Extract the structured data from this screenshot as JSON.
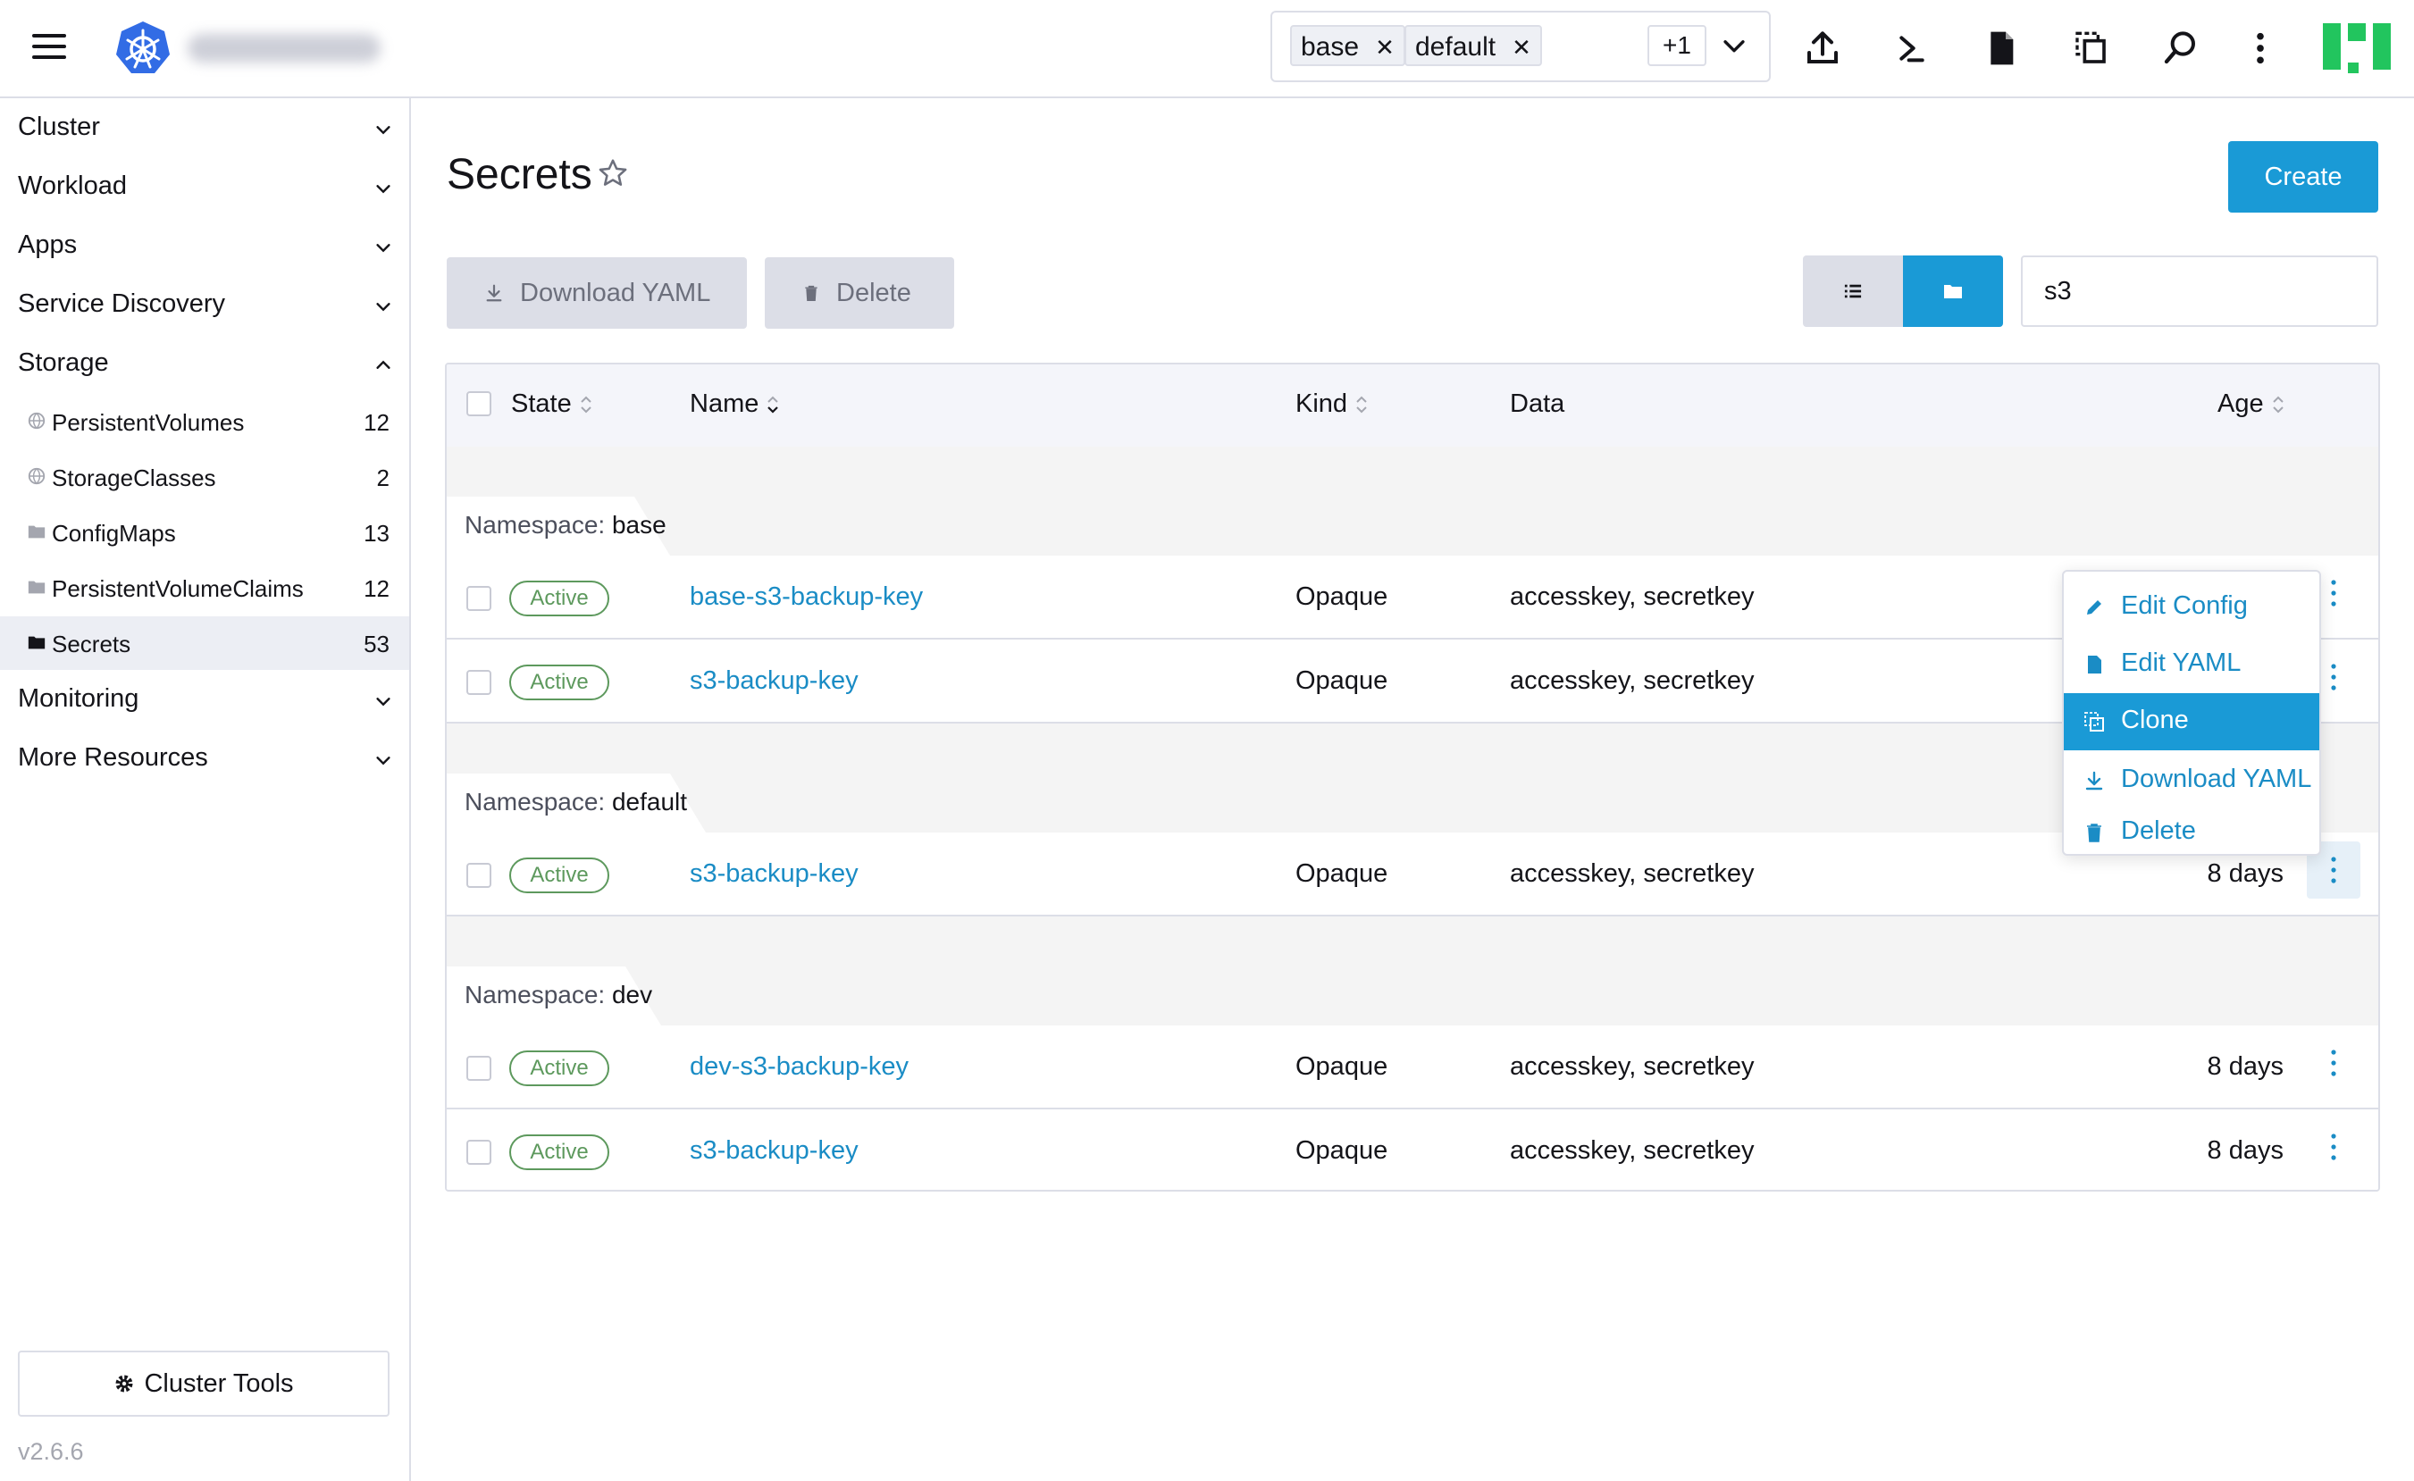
{
  "header": {
    "namespace_chips": [
      "base",
      "default"
    ],
    "more_namespaces": "+1"
  },
  "sidebar": {
    "groups": [
      {
        "label": "Cluster"
      },
      {
        "label": "Workload"
      },
      {
        "label": "Apps"
      },
      {
        "label": "Service Discovery"
      },
      {
        "label": "Storage"
      },
      {
        "label": "Monitoring"
      },
      {
        "label": "More Resources"
      }
    ],
    "storage_items": [
      {
        "label": "PersistentVolumes",
        "count": "12",
        "icon": "globe-icon"
      },
      {
        "label": "StorageClasses",
        "count": "2",
        "icon": "globe-icon"
      },
      {
        "label": "ConfigMaps",
        "count": "13",
        "icon": "folder-icon"
      },
      {
        "label": "PersistentVolumeClaims",
        "count": "12",
        "icon": "folder-icon"
      },
      {
        "label": "Secrets",
        "count": "53",
        "icon": "folder-icon",
        "active": true
      }
    ],
    "cluster_tools": "Cluster Tools",
    "version": "v2.6.6"
  },
  "main": {
    "title": "Secrets",
    "create_label": "Create",
    "download_yaml_label": "Download YAML",
    "delete_label": "Delete",
    "search_value": "s3",
    "columns": [
      "State",
      "Name",
      "Kind",
      "Data",
      "Age"
    ],
    "namespace_prefix": "Namespace:",
    "groups": [
      {
        "namespace": "base",
        "rows": [
          {
            "state": "Active",
            "name": "base-s3-backup-key",
            "kind": "Opaque",
            "data": "accesskey, secretkey",
            "age": ""
          },
          {
            "state": "Active",
            "name": "s3-backup-key",
            "kind": "Opaque",
            "data": "accesskey, secretkey",
            "age": ""
          }
        ]
      },
      {
        "namespace": "default",
        "rows": [
          {
            "state": "Active",
            "name": "s3-backup-key",
            "kind": "Opaque",
            "data": "accesskey, secretkey",
            "age": "8 days"
          }
        ]
      },
      {
        "namespace": "dev",
        "rows": [
          {
            "state": "Active",
            "name": "dev-s3-backup-key",
            "kind": "Opaque",
            "data": "accesskey, secretkey",
            "age": "8 days"
          },
          {
            "state": "Active",
            "name": "s3-backup-key",
            "kind": "Opaque",
            "data": "accesskey, secretkey",
            "age": "8 days"
          }
        ]
      }
    ]
  },
  "context_menu": {
    "items": [
      {
        "label": "Edit Config",
        "icon": "pencil-icon"
      },
      {
        "label": "Edit YAML",
        "icon": "file-icon"
      },
      {
        "label": "Clone",
        "icon": "clone-icon",
        "highlighted": true
      },
      {
        "label": "Download YAML",
        "icon": "download-icon"
      },
      {
        "label": "Delete",
        "icon": "trash-icon"
      }
    ]
  },
  "colors": {
    "accent": "#1a9ad6",
    "link": "#1a8cc5",
    "active_badge": "#5d995d",
    "brand_logo": "#326ce5",
    "avatar": "#22c55e"
  }
}
